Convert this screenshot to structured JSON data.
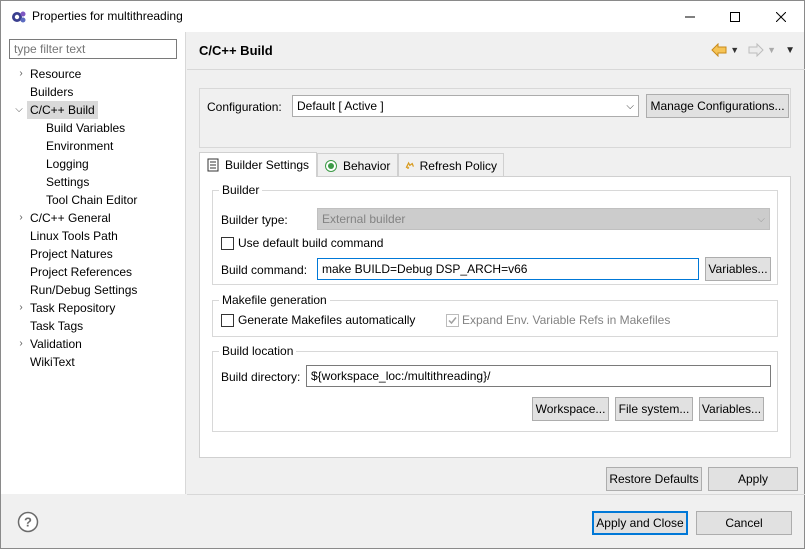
{
  "window": {
    "title": "Properties for multithreading"
  },
  "sidebar": {
    "filter_placeholder": "type filter text",
    "items": [
      {
        "label": "Resource",
        "expandable": true
      },
      {
        "label": "Builders",
        "expandable": false
      },
      {
        "label": "C/C++ Build",
        "expandable": true,
        "expanded": true,
        "selected": true
      },
      {
        "label": "Build Variables",
        "child": true
      },
      {
        "label": "Environment",
        "child": true
      },
      {
        "label": "Logging",
        "child": true
      },
      {
        "label": "Settings",
        "child": true
      },
      {
        "label": "Tool Chain Editor",
        "child": true
      },
      {
        "label": "C/C++ General",
        "expandable": true
      },
      {
        "label": "Linux Tools Path",
        "expandable": false
      },
      {
        "label": "Project Natures",
        "expandable": false
      },
      {
        "label": "Project References",
        "expandable": false
      },
      {
        "label": "Run/Debug Settings",
        "expandable": false
      },
      {
        "label": "Task Repository",
        "expandable": true
      },
      {
        "label": "Task Tags",
        "expandable": false
      },
      {
        "label": "Validation",
        "expandable": true
      },
      {
        "label": "WikiText",
        "expandable": false
      }
    ]
  },
  "main": {
    "title": "C/C++ Build",
    "configuration": {
      "label": "Configuration:",
      "value": "Default  [ Active ]",
      "manage_button": "Manage Configurations..."
    },
    "tabs": [
      {
        "label": "Builder Settings",
        "icon": "builder-settings-icon",
        "active": true
      },
      {
        "label": "Behavior",
        "icon": "behavior-icon",
        "active": false
      },
      {
        "label": "Refresh Policy",
        "icon": "refresh-policy-icon",
        "active": false
      }
    ],
    "builder": {
      "group_title": "Builder",
      "type_label": "Builder type:",
      "type_value": "External builder",
      "use_default_label": "Use default build command",
      "use_default_checked": false,
      "command_label": "Build command:",
      "command_value": "make BUILD=Debug DSP_ARCH=v66",
      "variables_button": "Variables..."
    },
    "makefile": {
      "group_title": "Makefile generation",
      "generate_label": "Generate Makefiles automatically",
      "generate_checked": false,
      "expand_label": "Expand Env. Variable Refs in Makefiles",
      "expand_checked": true,
      "expand_enabled": false
    },
    "location": {
      "group_title": "Build location",
      "dir_label": "Build directory:",
      "dir_value": "${workspace_loc:/multithreading}/",
      "workspace_button": "Workspace...",
      "filesystem_button": "File system...",
      "variables_button": "Variables..."
    },
    "restore_defaults_button": "Restore Defaults",
    "apply_button": "Apply"
  },
  "footer": {
    "apply_close_button": "Apply and Close",
    "cancel_button": "Cancel"
  },
  "colors": {
    "accent": "#0078d7",
    "selection": "#d9d9d9",
    "back_arrow": "#e8a33a"
  }
}
